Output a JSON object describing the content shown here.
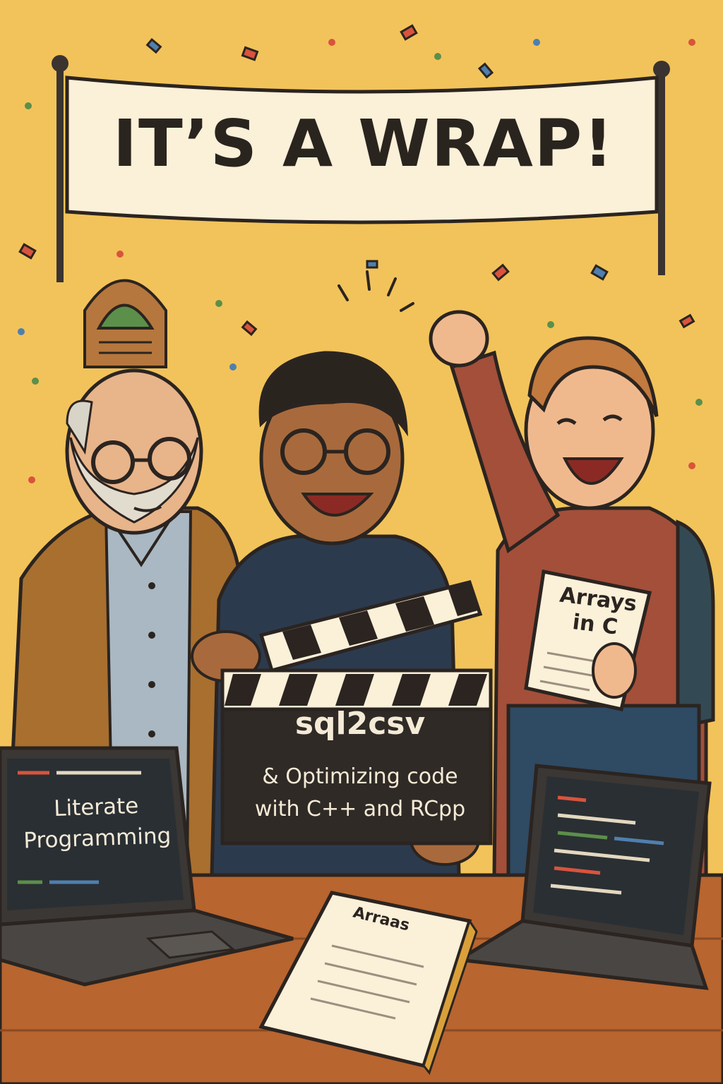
{
  "banner": {
    "text": "IT’S A WRAP!"
  },
  "clapperboard": {
    "title": "sql2csv",
    "subtitle_line1": "& Optimizing code",
    "subtitle_line2": "with C++ and RCpp"
  },
  "laptop_left": {
    "line1": "Literate",
    "line2": "Programming"
  },
  "paper_held": {
    "line1": "Arrays",
    "line2": "in C"
  },
  "paper_desk": {
    "text": "Arraas"
  },
  "colors": {
    "background": "#f2c35a",
    "banner": "#fbf0d8",
    "desk": "#b8652f",
    "clapperboard": "#2f2a26",
    "outline": "#2b2420"
  }
}
